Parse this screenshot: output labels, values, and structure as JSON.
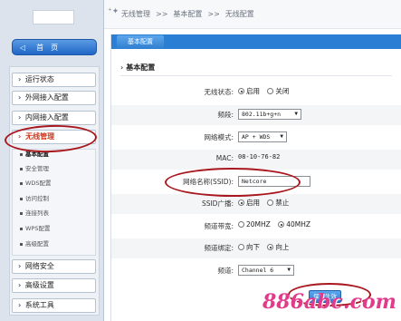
{
  "breadcrumb": {
    "items": [
      "无线管理",
      "基本配置",
      "无线配置"
    ],
    "separator": ">>"
  },
  "sidebar": {
    "home_label": "首　页",
    "items": [
      {
        "label": "运行状态"
      },
      {
        "label": "外网接入配置"
      },
      {
        "label": "内网接入配置"
      },
      {
        "label": "无线管理",
        "active": true
      },
      {
        "label": "网络安全"
      },
      {
        "label": "高级设置"
      },
      {
        "label": "系统工具"
      }
    ],
    "sub_items": [
      {
        "label": "基本配置",
        "active": true
      },
      {
        "label": "安全管理"
      },
      {
        "label": "WDS配置"
      },
      {
        "label": "访问控制"
      },
      {
        "label": "连接列表"
      },
      {
        "label": "WPS配置"
      },
      {
        "label": "高级配置"
      }
    ]
  },
  "main": {
    "tab_label": "基本配置",
    "section_title": "基本配置",
    "fields": {
      "wireless_status": {
        "label": "无线状态:",
        "options": [
          "启用",
          "关闭"
        ],
        "selected": "启用"
      },
      "band": {
        "label": "频段:",
        "value": "802.11b+g+n"
      },
      "network_mode": {
        "label": "网络模式:",
        "value": "AP + WDS"
      },
      "mac": {
        "label": "MAC:",
        "value": "08-10-76-82"
      },
      "ssid": {
        "label": "网络名称(SSID):",
        "value": "Netcore"
      },
      "ssid_broadcast": {
        "label": "SSID广播:",
        "options": [
          "启用",
          "禁止"
        ],
        "selected": "启用"
      },
      "bandwidth": {
        "label": "频道带宽:",
        "options": [
          "20MHZ",
          "40MHZ"
        ],
        "selected": "40MHZ"
      },
      "channel_bind": {
        "label": "频道绑定:",
        "options": [
          "向下",
          "向上"
        ],
        "selected": "向上"
      },
      "channel": {
        "label": "频道:",
        "value": "Channel 6"
      }
    },
    "save_label": "保存生效"
  },
  "watermark": "886abc.com",
  "colors": {
    "accent": "#2a7fd4",
    "annotation": "#a8171d",
    "watermark": "#e23a8c",
    "active_nav": "#d0371c"
  }
}
